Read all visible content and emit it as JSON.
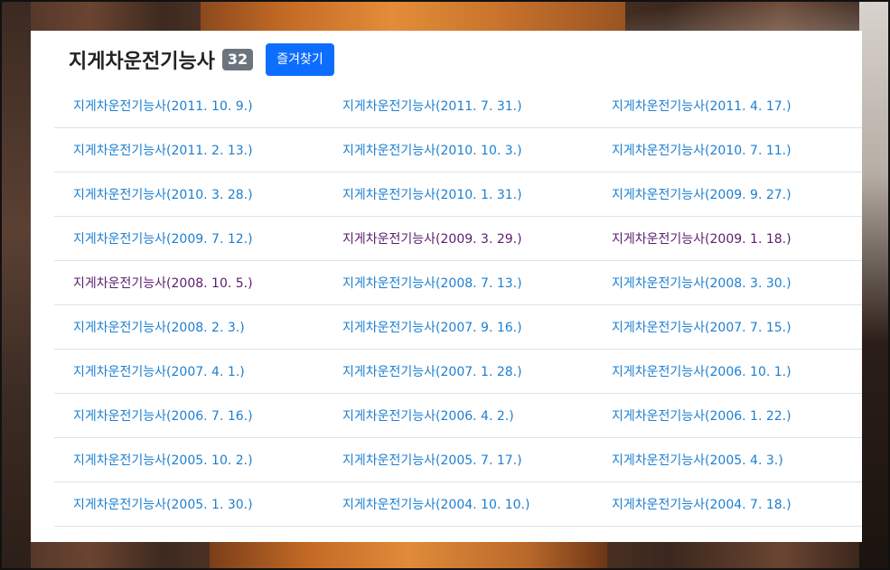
{
  "header": {
    "title": "지게차운전기능사",
    "count": "32",
    "favorite_label": "즐겨찾기"
  },
  "colors": {
    "link": "#1d7fd0",
    "visited_link": "#5a1e6e",
    "badge": "#6c757d",
    "primary_button": "#0d6efd"
  },
  "rows": [
    [
      {
        "label": "지게차운전기능사(2011. 10. 9.)",
        "visited": false
      },
      {
        "label": "지게차운전기능사(2011. 7. 31.)",
        "visited": false
      },
      {
        "label": "지게차운전기능사(2011. 4. 17.)",
        "visited": false
      }
    ],
    [
      {
        "label": "지게차운전기능사(2011. 2. 13.)",
        "visited": false
      },
      {
        "label": "지게차운전기능사(2010. 10. 3.)",
        "visited": false
      },
      {
        "label": "지게차운전기능사(2010. 7. 11.)",
        "visited": false
      }
    ],
    [
      {
        "label": "지게차운전기능사(2010. 3. 28.)",
        "visited": false
      },
      {
        "label": "지게차운전기능사(2010. 1. 31.)",
        "visited": false
      },
      {
        "label": "지게차운전기능사(2009. 9. 27.)",
        "visited": false
      }
    ],
    [
      {
        "label": "지게차운전기능사(2009. 7. 12.)",
        "visited": false
      },
      {
        "label": "지게차운전기능사(2009. 3. 29.)",
        "visited": true
      },
      {
        "label": "지게차운전기능사(2009. 1. 18.)",
        "visited": true
      }
    ],
    [
      {
        "label": "지게차운전기능사(2008. 10. 5.)",
        "visited": true
      },
      {
        "label": "지게차운전기능사(2008. 7. 13.)",
        "visited": false
      },
      {
        "label": "지게차운전기능사(2008. 3. 30.)",
        "visited": false
      }
    ],
    [
      {
        "label": "지게차운전기능사(2008. 2. 3.)",
        "visited": false
      },
      {
        "label": "지게차운전기능사(2007. 9. 16.)",
        "visited": false
      },
      {
        "label": "지게차운전기능사(2007. 7. 15.)",
        "visited": false
      }
    ],
    [
      {
        "label": "지게차운전기능사(2007. 4. 1.)",
        "visited": false
      },
      {
        "label": "지게차운전기능사(2007. 1. 28.)",
        "visited": false
      },
      {
        "label": "지게차운전기능사(2006. 10. 1.)",
        "visited": false
      }
    ],
    [
      {
        "label": "지게차운전기능사(2006. 7. 16.)",
        "visited": false
      },
      {
        "label": "지게차운전기능사(2006. 4. 2.)",
        "visited": false
      },
      {
        "label": "지게차운전기능사(2006. 1. 22.)",
        "visited": false
      }
    ],
    [
      {
        "label": "지게차운전기능사(2005. 10. 2.)",
        "visited": false
      },
      {
        "label": "지게차운전기능사(2005. 7. 17.)",
        "visited": false
      },
      {
        "label": "지게차운전기능사(2005. 4. 3.)",
        "visited": false
      }
    ],
    [
      {
        "label": "지게차운전기능사(2005. 1. 30.)",
        "visited": false
      },
      {
        "label": "지게차운전기능사(2004. 10. 10.)",
        "visited": false
      },
      {
        "label": "지게차운전기능사(2004. 7. 18.)",
        "visited": false
      }
    ]
  ]
}
